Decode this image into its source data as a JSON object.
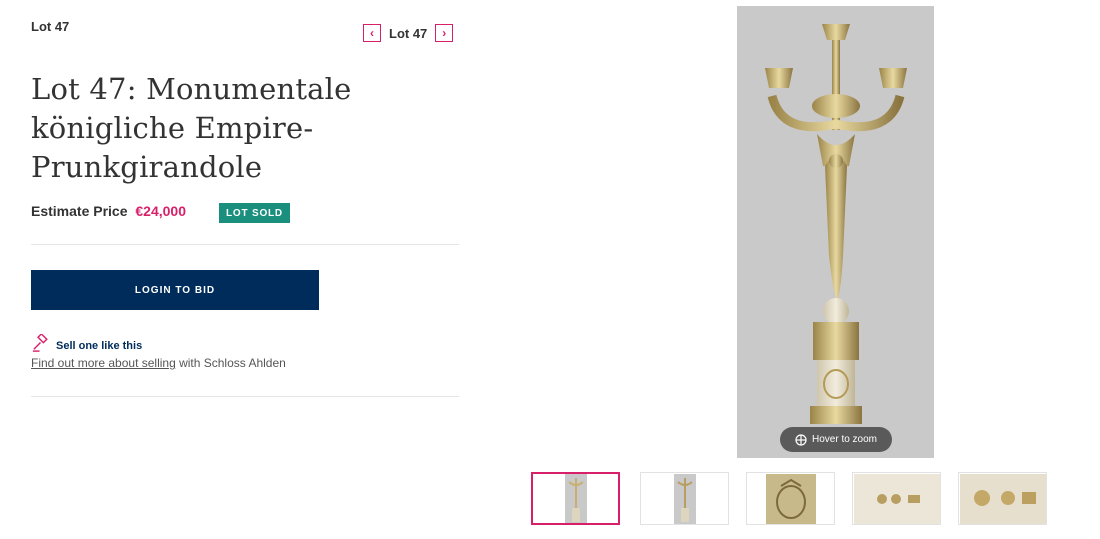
{
  "lot": {
    "label": "Lot 47",
    "nav_label": "Lot 47",
    "title": "Lot 47: Monumentale königliche Empire-Prunkgirandole",
    "estimate_label": "Estimate Price",
    "estimate_value": "€24,000",
    "status": "LOT SOLD"
  },
  "actions": {
    "login_label": "LOGIN TO BID",
    "sell_label": "Sell one like this",
    "find_link": "Find out more about selling",
    "find_suffix": " with Schloss Ahlden"
  },
  "gallery": {
    "zoom_label": "Hover to zoom",
    "thumbnails": [
      "candelabra-full",
      "candelabra-small",
      "coat-of-arms",
      "hallmarks",
      "hallmarks-closeup"
    ],
    "active_index": 0
  },
  "colors": {
    "accent": "#d81f6a",
    "navy": "#002c5b",
    "sold": "#1a8f7d"
  }
}
